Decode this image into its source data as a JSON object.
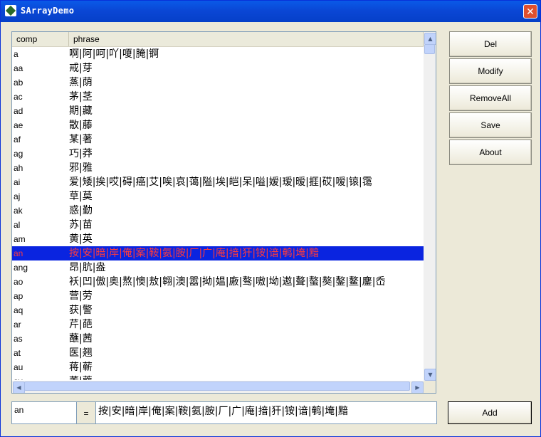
{
  "window": {
    "title": "SArrayDemo",
    "close_glyph": "✕"
  },
  "list": {
    "columns": [
      "comp",
      "phrase"
    ],
    "rows": [
      {
        "comp": "a",
        "phrase": "啊|阿|呵|吖|嗄|腌|锕"
      },
      {
        "comp": "aa",
        "phrase": "戒|芽"
      },
      {
        "comp": "ab",
        "phrase": "蒸|荫"
      },
      {
        "comp": "ac",
        "phrase": "茅|茎"
      },
      {
        "comp": "ad",
        "phrase": "期|藏"
      },
      {
        "comp": "ae",
        "phrase": "散|藤"
      },
      {
        "comp": "af",
        "phrase": "某|著"
      },
      {
        "comp": "ag",
        "phrase": "巧|莽"
      },
      {
        "comp": "ah",
        "phrase": "邪|雅"
      },
      {
        "comp": "ai",
        "phrase": "爱|矮|挨|哎|碍|癌|艾|唉|哀|蔼|隘|埃|皑|呆|嗌|嫒|瑷|暧|捱|砹|嗳|锿|霭"
      },
      {
        "comp": "aj",
        "phrase": "草|莫"
      },
      {
        "comp": "ak",
        "phrase": "惑|勤"
      },
      {
        "comp": "al",
        "phrase": "苏|苗"
      },
      {
        "comp": "am",
        "phrase": "黄|英"
      },
      {
        "comp": "an",
        "phrase": "按|安|暗|岸|俺|案|鞍|氨|胺|厂|广|庵|揞|犴|铵|谙|鹌|埯|黯",
        "selected": true
      },
      {
        "comp": "ang",
        "phrase": "昂|肮|盎"
      },
      {
        "comp": "ao",
        "phrase": "袄|凹|傲|奥|熬|懊|敖|翱|澳|嚣|拗|媪|廒|骜|嗷|坳|遨|聱|螯|獒|鏊|鳌|鏖|岙"
      },
      {
        "comp": "ap",
        "phrase": "营|劳"
      },
      {
        "comp": "aq",
        "phrase": "获|警"
      },
      {
        "comp": "ar",
        "phrase": "芹|葩"
      },
      {
        "comp": "as",
        "phrase": "蘸|茜"
      },
      {
        "comp": "at",
        "phrase": "医|翘"
      },
      {
        "comp": "au",
        "phrase": "蒋|蕲"
      },
      {
        "comp": "av",
        "phrase": "董|蔻"
      }
    ]
  },
  "buttons": {
    "del": "Del",
    "modify": "Modify",
    "remove_all": "RemoveAll",
    "save": "Save",
    "about": "About",
    "add": "Add"
  },
  "editor": {
    "comp_value": "an",
    "equals": "=",
    "phrase_value": "按|安|暗|岸|俺|案|鞍|氨|胺|厂|广|庵|揞|犴|铵|谙|鹌|埯|黯"
  },
  "scroll_icons": {
    "up": "▲",
    "down": "▼",
    "left": "◀",
    "right": "▶"
  }
}
